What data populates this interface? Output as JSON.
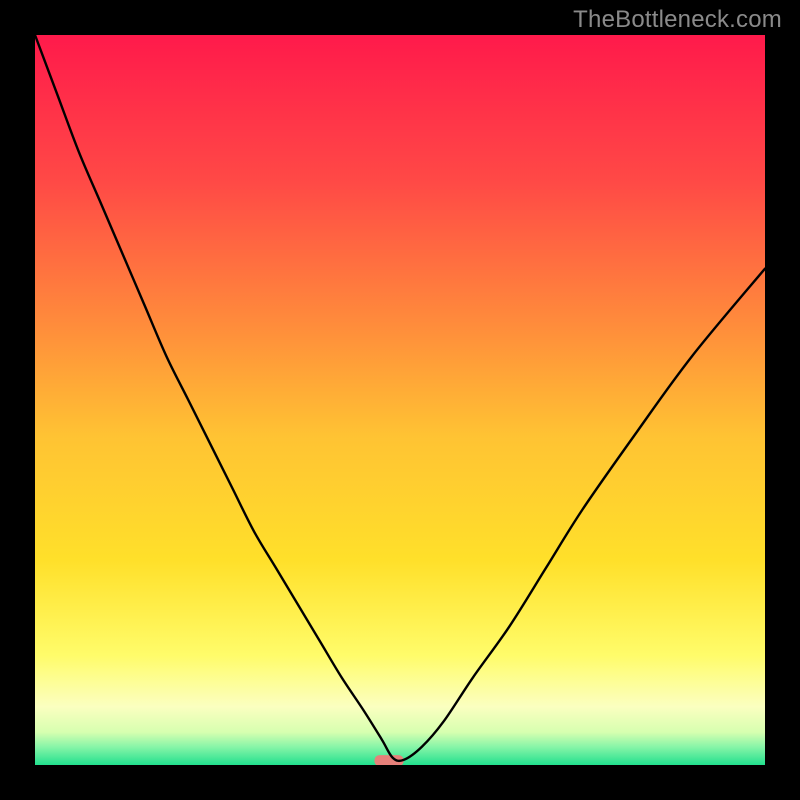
{
  "watermark": "TheBottleneck.com",
  "chart_data": {
    "type": "line",
    "title": "",
    "xlabel": "",
    "ylabel": "",
    "xlim": [
      0,
      100
    ],
    "ylim": [
      0,
      100
    ],
    "grid": false,
    "legend": false,
    "x": [
      0,
      3,
      6,
      9,
      12,
      15,
      18,
      21,
      24,
      27,
      30,
      33,
      36,
      39,
      42,
      45,
      47.5,
      49,
      50.5,
      53,
      56,
      60,
      65,
      70,
      75,
      82,
      90,
      100
    ],
    "y": [
      100,
      92,
      84,
      77,
      70,
      63,
      56,
      50,
      44,
      38,
      32,
      27,
      22,
      17,
      12,
      7.5,
      3.5,
      1,
      0.7,
      2.5,
      6,
      12,
      19,
      27,
      35,
      45,
      56,
      68
    ],
    "marker": {
      "x_range": [
        46.5,
        50.5
      ],
      "y": 0.6,
      "color": "#e6807a",
      "shape": "pill"
    },
    "background_gradient": {
      "type": "vertical",
      "stops": [
        {
          "offset": 0.0,
          "color": "#ff1a4b"
        },
        {
          "offset": 0.2,
          "color": "#ff4946"
        },
        {
          "offset": 0.4,
          "color": "#ff8d3b"
        },
        {
          "offset": 0.55,
          "color": "#ffc333"
        },
        {
          "offset": 0.72,
          "color": "#ffe02a"
        },
        {
          "offset": 0.85,
          "color": "#fffc6a"
        },
        {
          "offset": 0.92,
          "color": "#fbffc0"
        },
        {
          "offset": 0.955,
          "color": "#d7ffb0"
        },
        {
          "offset": 0.975,
          "color": "#88f5a8"
        },
        {
          "offset": 1.0,
          "color": "#22e08e"
        }
      ]
    },
    "curve_style": {
      "stroke": "#000000",
      "width": 2.4
    }
  }
}
